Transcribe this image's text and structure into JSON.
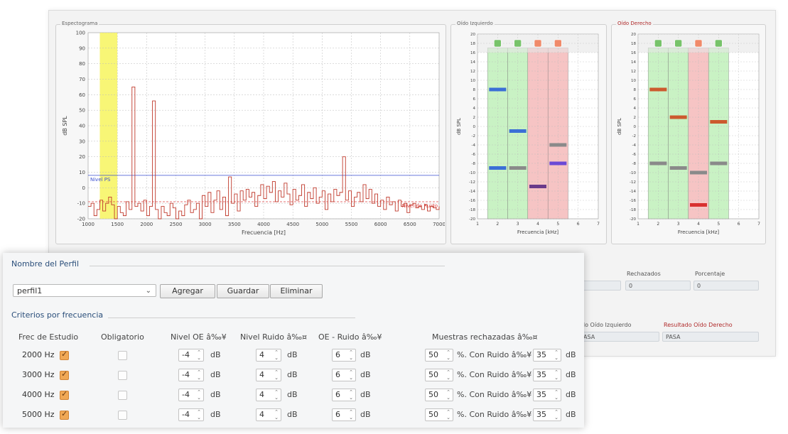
{
  "spectrogram": {
    "title": "Espectograma",
    "ylabel": "dB SPL",
    "xlabel": "Frecuencia [Hz]",
    "yticks": [
      "100",
      "90",
      "80",
      "70",
      "60",
      "50",
      "40",
      "30",
      "20",
      "10",
      "0",
      "-10",
      "-20"
    ],
    "xticks": [
      "1000",
      "1500",
      "2000",
      "2500",
      "3000",
      "3500",
      "4000",
      "4500",
      "5000",
      "5500",
      "6000",
      "6500",
      "7000"
    ],
    "ps_label": "Nivel PS",
    "noise_label": "Nivel de Ruido",
    "colors": {
      "band": "#f7f45e",
      "line": "#c0392b",
      "ps": "#3a4fd0",
      "noise": "#d44"
    }
  },
  "chart_data": [
    {
      "type": "line",
      "title": "Espectograma",
      "xlabel": "Frecuencia [Hz]",
      "ylabel": "dB SPL",
      "xlim": [
        1000,
        7000
      ],
      "ylim": [
        -20,
        100
      ],
      "ps_level": 8,
      "noise_level": -9,
      "highlight_band": [
        1200,
        1500
      ],
      "x": [
        1000,
        1050,
        1100,
        1150,
        1200,
        1250,
        1300,
        1350,
        1400,
        1450,
        1500,
        1550,
        1600,
        1650,
        1700,
        1750,
        1800,
        1850,
        1900,
        1950,
        2000,
        2050,
        2100,
        2150,
        2200,
        2250,
        2300,
        2350,
        2400,
        2450,
        2500,
        2550,
        2600,
        2650,
        2700,
        2750,
        2800,
        2850,
        2900,
        2950,
        3000,
        3050,
        3100,
        3150,
        3200,
        3250,
        3300,
        3350,
        3400,
        3450,
        3500,
        3550,
        3600,
        3650,
        3700,
        3750,
        3800,
        3850,
        3900,
        3950,
        4000,
        4050,
        4100,
        4150,
        4200,
        4250,
        4300,
        4350,
        4400,
        4450,
        4500,
        4550,
        4600,
        4650,
        4700,
        4750,
        4800,
        4850,
        4900,
        4950,
        5000,
        5050,
        5100,
        5150,
        5200,
        5250,
        5300,
        5350,
        5400,
        5450,
        5500,
        5550,
        5600,
        5650,
        5700,
        5750,
        5800,
        5850,
        5900,
        5950,
        6000,
        6050,
        6100,
        6150,
        6200,
        6250,
        6300,
        6350,
        6400,
        6450,
        6500,
        6550,
        6600,
        6650,
        6700,
        6750,
        6800,
        6850,
        6900,
        6950,
        7000
      ],
      "y": [
        -12,
        -10,
        -18,
        -14,
        -8,
        -15,
        -10,
        -6,
        -11,
        -20,
        -12,
        -16,
        -18,
        -9,
        -14,
        65,
        -12,
        -10,
        -15,
        -8,
        -18,
        -12,
        56,
        -14,
        -20,
        -12,
        -16,
        -18,
        -10,
        -13,
        -20,
        -15,
        -18,
        -11,
        -8,
        -16,
        -14,
        -10,
        -20,
        -5,
        -12,
        -3,
        -16,
        -8,
        -2,
        -14,
        -6,
        -18,
        7,
        -10,
        -4,
        -15,
        -2,
        -8,
        -1,
        -6,
        -3,
        -12,
        -5,
        2,
        -7,
        1,
        -3,
        4,
        -9,
        -2,
        -6,
        3,
        -4,
        -11,
        -1,
        -8,
        -5,
        2,
        -12,
        -3,
        -7,
        0,
        -10,
        -6,
        -2,
        -14,
        -4,
        -9,
        -1,
        -5,
        -3,
        20,
        -8,
        -2,
        -12,
        -6,
        -3,
        -9,
        2,
        -7,
        -1,
        -10,
        -4,
        -12,
        -8,
        -14,
        -6,
        -11,
        -9,
        -15,
        -8,
        -12,
        -10,
        -16,
        -11,
        -10,
        -13,
        -12,
        -14,
        -11,
        -15,
        -12,
        -13,
        -14,
        -12
      ]
    },
    {
      "type": "bar",
      "title": "Oido Izquierdo",
      "xlabel": "Frecuencia [kHz]",
      "ylabel": "dB SPL",
      "xlim": [
        1,
        7
      ],
      "ylim": [
        -20,
        20
      ],
      "categories": [
        "2",
        "3",
        "4",
        "5"
      ],
      "status": [
        "pass",
        "pass",
        "fail",
        "fail"
      ],
      "oe_values": [
        8,
        null,
        -13,
        -8
      ],
      "oe_values_b": [
        -9,
        -1,
        null,
        null
      ],
      "noise_values": [
        -9,
        -9,
        -13,
        -4
      ],
      "bar_colors": [
        "#3b6fd6",
        "#3b6fd6",
        "#6a3a8a",
        "#6b49d6"
      ]
    },
    {
      "type": "bar",
      "title": "Oido Derecho",
      "xlabel": "Frecuencia [kHz]",
      "ylabel": "dB SPL",
      "xlim": [
        1,
        7
      ],
      "ylim": [
        -20,
        20
      ],
      "categories": [
        "2",
        "3",
        "4",
        "5"
      ],
      "status": [
        "pass",
        "pass",
        "fail",
        "pass"
      ],
      "oe_values": [
        8,
        2,
        -17,
        1
      ],
      "noise_values": [
        -8,
        -9,
        -10,
        -8
      ],
      "bar_colors": [
        "#cc5a2e",
        "#cc5a2e",
        "#d93030",
        "#cc5a2e"
      ]
    }
  ],
  "left_ear": {
    "title": "Oído Izquierdo",
    "ylabel": "dB SPL",
    "xlabel": "Frecuencia [kHz]",
    "xticks": [
      "1",
      "2",
      "3",
      "4",
      "5",
      "6",
      "7"
    ],
    "yticks": [
      "20",
      "18",
      "16",
      "14",
      "12",
      "10",
      "8",
      "6",
      "4",
      "2",
      "0",
      "-2",
      "-4",
      "-6",
      "-8",
      "-10",
      "-12",
      "-14",
      "-16",
      "-18",
      "-20"
    ]
  },
  "right_ear": {
    "title": "Oído Derecho",
    "ylabel": "dB SPL",
    "xlabel": "Frecuencia [kHz]",
    "xticks": [
      "1",
      "2",
      "3",
      "4",
      "5",
      "6",
      "7"
    ],
    "yticks": [
      "20",
      "18",
      "16",
      "14",
      "12",
      "10",
      "8",
      "6",
      "4",
      "2",
      "0",
      "-2",
      "-4",
      "-6",
      "-8",
      "-10",
      "-12",
      "-14",
      "-16",
      "-18",
      "-20"
    ]
  },
  "results": {
    "rejected_label": "Rechazados",
    "percent_label": "Porcentaje",
    "rejected_value": "0",
    "percent_value": "0",
    "left_result_label": "do Oído Izquierdo",
    "right_result_label": "Resultado Oído Derecho",
    "left_result_value": "ASA",
    "right_result_value": "PASA"
  },
  "profile": {
    "section_title": "Nombre del Perfil",
    "selected": "perfil1",
    "buttons": {
      "add": "Agregar",
      "save": "Guardar",
      "delete": "Eliminar"
    }
  },
  "criteria": {
    "section_title": "Criterios por frecuencia",
    "headers": {
      "freq": "Frec de Estudio",
      "mandatory": "Obligatorio",
      "oe": "Nivel OE â‰¥",
      "noise": "Nivel Ruido â‰¤",
      "oe_noise": "OE - Ruido â‰¥",
      "rejected": "Muestras rechazadas â‰¤"
    },
    "units": {
      "db": "dB",
      "pct_noise": "%. Con Ruido â‰¥"
    },
    "rows": [
      {
        "freq": "2000 Hz",
        "enabled": true,
        "mandatory": false,
        "oe": "-4",
        "noise": "4",
        "oe_noise": "6",
        "rej_pct": "50",
        "noise_thr": "35"
      },
      {
        "freq": "3000 Hz",
        "enabled": true,
        "mandatory": false,
        "oe": "-4",
        "noise": "4",
        "oe_noise": "6",
        "rej_pct": "50",
        "noise_thr": "35"
      },
      {
        "freq": "4000 Hz",
        "enabled": true,
        "mandatory": false,
        "oe": "-4",
        "noise": "4",
        "oe_noise": "6",
        "rej_pct": "50",
        "noise_thr": "35"
      },
      {
        "freq": "5000 Hz",
        "enabled": true,
        "mandatory": false,
        "oe": "-4",
        "noise": "4",
        "oe_noise": "6",
        "rej_pct": "50",
        "noise_thr": "35"
      }
    ]
  }
}
